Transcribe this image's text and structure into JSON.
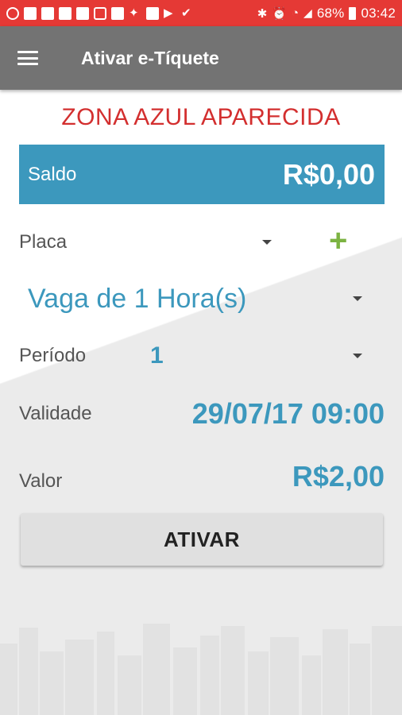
{
  "status_bar": {
    "battery": "68%",
    "time": "03:42"
  },
  "app_bar": {
    "title": "Ativar e-Tíquete"
  },
  "header": {
    "zone": "ZONA AZUL APARECIDA"
  },
  "saldo": {
    "label": "Saldo",
    "value": "R$0,00"
  },
  "form": {
    "placa_label": "Placa",
    "vaga_value": "Vaga de 1 Hora(s)",
    "periodo_label": "Período",
    "periodo_value": "1",
    "validade_label": "Validade",
    "validade_value": "29/07/17 09:00",
    "valor_label": "Valor",
    "valor_value": "R$2,00"
  },
  "actions": {
    "ativar_label": "ATIVAR"
  },
  "colors": {
    "status_bar": "#e53935",
    "app_bar": "#737373",
    "accent_blue": "#3c98bd",
    "title_red": "#d32f2f",
    "plus_green": "#7cb342"
  }
}
